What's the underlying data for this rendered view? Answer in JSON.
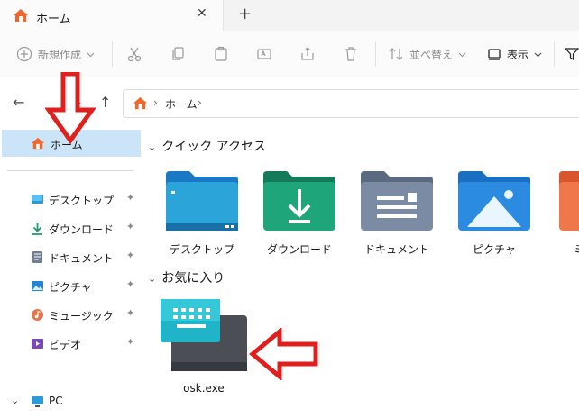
{
  "tab": {
    "title": "ホーム",
    "close_symbol": "✕",
    "new_tab_symbol": "+"
  },
  "toolbar": {
    "new_label": "新規作成",
    "sort_label": "並べ替え",
    "view_label": "表示"
  },
  "address": {
    "segments": [
      "ホーム"
    ],
    "separator": "›"
  },
  "nav": {
    "back": "←",
    "forward": "→",
    "up": "↑"
  },
  "sidebar": {
    "home_label": "ホーム",
    "quick_items": [
      {
        "label": "デスクトップ",
        "icon": "desktop-icon"
      },
      {
        "label": "ダウンロード",
        "icon": "download-icon"
      },
      {
        "label": "ドキュメント",
        "icon": "document-icon"
      },
      {
        "label": "ピクチャ",
        "icon": "picture-icon"
      },
      {
        "label": "ミュージック",
        "icon": "music-icon"
      },
      {
        "label": "ビデオ",
        "icon": "video-icon"
      }
    ],
    "pc_label": "PC",
    "pin_symbol": "📌"
  },
  "main": {
    "quick_access_title": "クイック アクセス",
    "favorites_title": "お気に入り",
    "folders": [
      "デスクトップ",
      "ダウンロード",
      "ドキュメント",
      "ピクチャ",
      "ミ"
    ],
    "favorite_file": "osk.exe"
  },
  "colors": {
    "accent": "#0078d4",
    "selection": "#cce4f7",
    "arrow_red": "#e0201c",
    "home_orange": "#f0662d"
  }
}
